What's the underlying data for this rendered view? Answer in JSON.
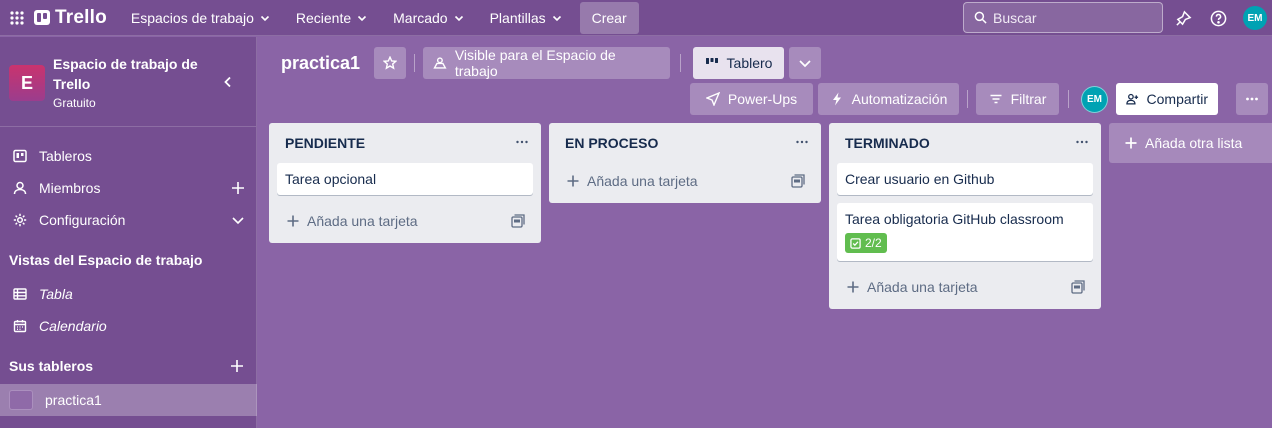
{
  "topnav": {
    "logo": "Trello",
    "items": [
      {
        "label": "Espacios de trabajo"
      },
      {
        "label": "Reciente"
      },
      {
        "label": "Marcado"
      },
      {
        "label": "Plantillas"
      }
    ],
    "create_label": "Crear",
    "search_placeholder": "Buscar",
    "avatar_initials": "EM"
  },
  "sidebar": {
    "workspace_initial": "E",
    "workspace_name": "Espacio de trabajo de Trello",
    "workspace_plan": "Gratuito",
    "items": [
      {
        "label": "Tableros",
        "icon": "board-icon"
      },
      {
        "label": "Miembros",
        "icon": "person-icon"
      },
      {
        "label": "Configuración",
        "icon": "gear-icon"
      }
    ],
    "views_heading": "Vistas del Espacio de trabajo",
    "views": [
      {
        "label": "Tabla",
        "icon": "table-icon"
      },
      {
        "label": "Calendario",
        "icon": "calendar-icon"
      }
    ],
    "boards_heading": "Sus tableros",
    "boards": [
      {
        "label": "practica1",
        "color": "#8f6aa8",
        "active": true
      }
    ]
  },
  "board": {
    "title": "practica1",
    "visibility_label": "Visible para el Espacio de trabajo",
    "view_label": "Tablero",
    "powerups_label": "Power-Ups",
    "automation_label": "Automatización",
    "filter_label": "Filtrar",
    "member_initials": "EM",
    "share_label": "Compartir",
    "add_list_label": "Añada otra lista"
  },
  "lists": [
    {
      "title": "PENDIENTE",
      "cards": [
        {
          "title": "Tarea opcional"
        }
      ],
      "add_card_label": "Añada una tarjeta"
    },
    {
      "title": "EN PROCESO",
      "cards": [],
      "add_card_label": "Añada una tarjeta"
    },
    {
      "title": "TERMINADO",
      "cards": [
        {
          "title": "Crear usuario en Github"
        },
        {
          "title": "Tarea obligatoria GitHub classroom",
          "checklist": "2/2"
        }
      ],
      "add_card_label": "Añada una tarjeta"
    }
  ],
  "colors": {
    "board_bg": "#8a64a6",
    "nav_bg": "#754e91",
    "checklist_complete": "#61bd4f",
    "avatar": "#00a2b3"
  }
}
